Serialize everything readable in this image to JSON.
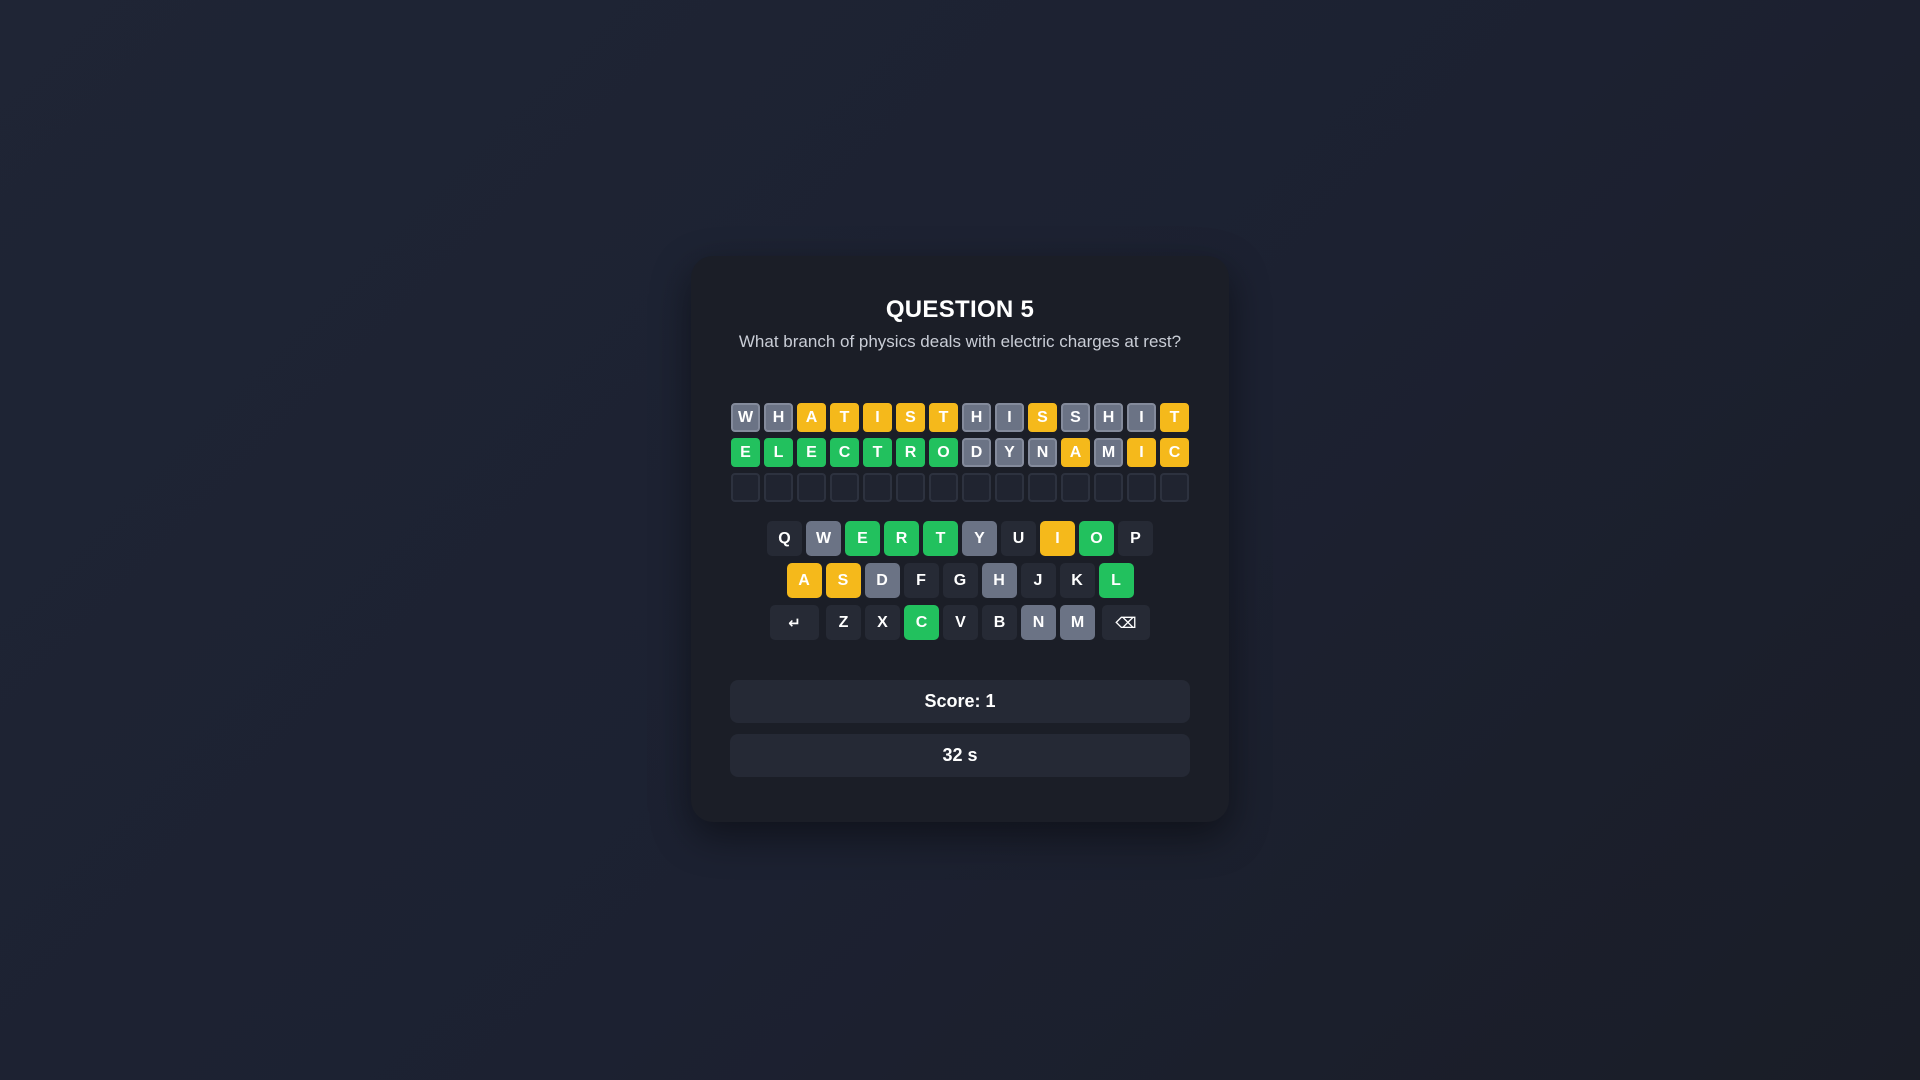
{
  "quiz": {
    "title": "QUESTION 5",
    "question": "What branch of physics deals with electric charges at rest?"
  },
  "board": {
    "rows": [
      [
        {
          "letter": "W",
          "state": "gray"
        },
        {
          "letter": "H",
          "state": "gray"
        },
        {
          "letter": "A",
          "state": "yellow"
        },
        {
          "letter": "T",
          "state": "yellow"
        },
        {
          "letter": "I",
          "state": "yellow"
        },
        {
          "letter": "S",
          "state": "yellow"
        },
        {
          "letter": "T",
          "state": "yellow"
        },
        {
          "letter": "H",
          "state": "gray"
        },
        {
          "letter": "I",
          "state": "gray"
        },
        {
          "letter": "S",
          "state": "yellow"
        },
        {
          "letter": "S",
          "state": "gray"
        },
        {
          "letter": "H",
          "state": "gray"
        },
        {
          "letter": "I",
          "state": "gray"
        },
        {
          "letter": "T",
          "state": "yellow"
        }
      ],
      [
        {
          "letter": "E",
          "state": "green"
        },
        {
          "letter": "L",
          "state": "green"
        },
        {
          "letter": "E",
          "state": "green"
        },
        {
          "letter": "C",
          "state": "green"
        },
        {
          "letter": "T",
          "state": "green"
        },
        {
          "letter": "R",
          "state": "green"
        },
        {
          "letter": "O",
          "state": "green"
        },
        {
          "letter": "D",
          "state": "gray"
        },
        {
          "letter": "Y",
          "state": "gray"
        },
        {
          "letter": "N",
          "state": "gray"
        },
        {
          "letter": "A",
          "state": "yellow"
        },
        {
          "letter": "M",
          "state": "gray"
        },
        {
          "letter": "I",
          "state": "yellow"
        },
        {
          "letter": "C",
          "state": "yellow"
        }
      ],
      [
        {
          "letter": "",
          "state": "empty"
        },
        {
          "letter": "",
          "state": "empty"
        },
        {
          "letter": "",
          "state": "empty"
        },
        {
          "letter": "",
          "state": "empty"
        },
        {
          "letter": "",
          "state": "empty"
        },
        {
          "letter": "",
          "state": "empty"
        },
        {
          "letter": "",
          "state": "empty"
        },
        {
          "letter": "",
          "state": "empty"
        },
        {
          "letter": "",
          "state": "empty"
        },
        {
          "letter": "",
          "state": "empty"
        },
        {
          "letter": "",
          "state": "empty"
        },
        {
          "letter": "",
          "state": "empty"
        },
        {
          "letter": "",
          "state": "empty"
        },
        {
          "letter": "",
          "state": "empty"
        }
      ]
    ]
  },
  "keyboard": {
    "rows": [
      [
        {
          "label": "Q",
          "state": "default"
        },
        {
          "label": "W",
          "state": "gray"
        },
        {
          "label": "E",
          "state": "green"
        },
        {
          "label": "R",
          "state": "green"
        },
        {
          "label": "T",
          "state": "green"
        },
        {
          "label": "Y",
          "state": "gray"
        },
        {
          "label": "U",
          "state": "default"
        },
        {
          "label": "I",
          "state": "yellow"
        },
        {
          "label": "O",
          "state": "green"
        },
        {
          "label": "P",
          "state": "default"
        }
      ],
      [
        {
          "label": "A",
          "state": "yellow"
        },
        {
          "label": "S",
          "state": "yellow"
        },
        {
          "label": "D",
          "state": "gray"
        },
        {
          "label": "F",
          "state": "default"
        },
        {
          "label": "G",
          "state": "default"
        },
        {
          "label": "H",
          "state": "gray"
        },
        {
          "label": "J",
          "state": "default"
        },
        {
          "label": "K",
          "state": "default"
        },
        {
          "label": "L",
          "state": "green"
        }
      ],
      [
        {
          "label": "↵",
          "state": "default",
          "kind": "enter",
          "icon": "enter-icon"
        },
        {
          "label": "Z",
          "state": "default"
        },
        {
          "label": "X",
          "state": "default"
        },
        {
          "label": "C",
          "state": "green"
        },
        {
          "label": "V",
          "state": "default"
        },
        {
          "label": "B",
          "state": "default"
        },
        {
          "label": "N",
          "state": "gray"
        },
        {
          "label": "M",
          "state": "gray"
        },
        {
          "label": "⌫",
          "state": "default",
          "kind": "backspace",
          "icon": "backspace-icon"
        }
      ]
    ]
  },
  "status": {
    "score": "Score: 1",
    "timer": "32 s"
  },
  "colors": {
    "correct": "#22c15e",
    "present": "#f5b91b",
    "absent": "#6b7385",
    "key_default": "#262a35",
    "card_bg": "#1b1e27",
    "page_bg": "#1f2535"
  }
}
